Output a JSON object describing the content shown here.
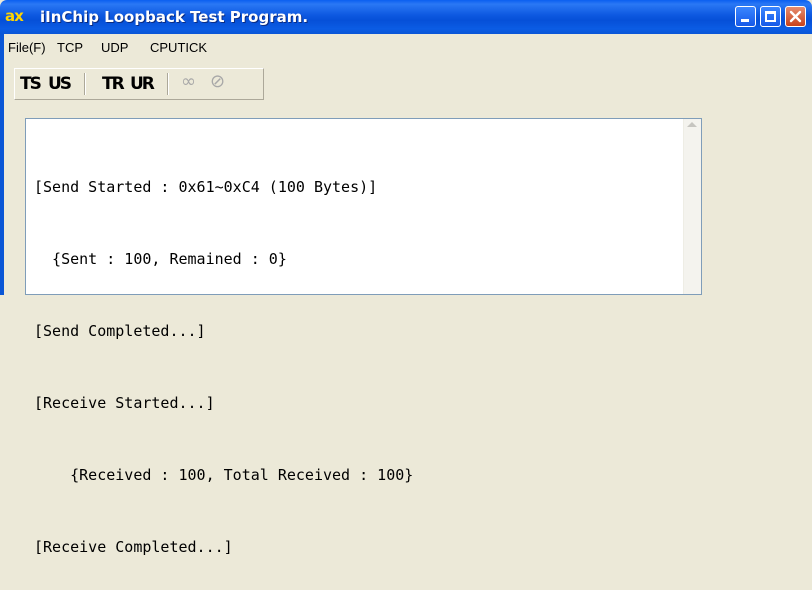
{
  "window": {
    "title": "iInChip Loopback Test Program.",
    "app_icon": "ax",
    "title_gradient": [
      "#0a5ff0",
      "#0650d8"
    ],
    "accent": "#ffd400"
  },
  "menu": {
    "items": [
      "File(F)",
      "TCP",
      "UDP",
      "CPUTICK"
    ]
  },
  "toolbar": {
    "buttons": [
      {
        "label": "TS",
        "icon": "tcp-send-icon"
      },
      {
        "label": "US",
        "icon": "udp-send-icon"
      },
      {
        "label": "TR",
        "icon": "tcp-receive-icon"
      },
      {
        "label": "UR",
        "icon": "udp-receive-icon"
      },
      {
        "label": "∞",
        "icon": "loop-icon",
        "disabled": true
      },
      {
        "label": "⊘",
        "icon": "stop-icon",
        "disabled": true
      }
    ]
  },
  "log": {
    "lines": [
      "[Send Started : 0x61~0xC4 (100 Bytes)]",
      "  {Sent : 100, Remained : 0}",
      "[Send Completed...]",
      "[Receive Started...]",
      "    {Received : 100, Total Received : 100}",
      "[Receive Completed...]"
    ]
  }
}
